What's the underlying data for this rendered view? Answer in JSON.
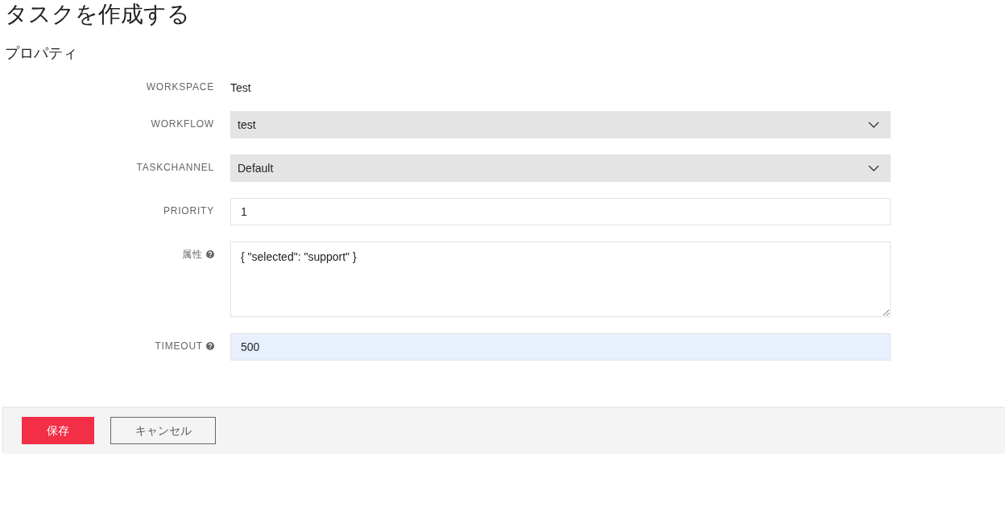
{
  "title": "タスクを作成する",
  "section": "プロパティ",
  "fields": [
    {
      "kind": "static",
      "label": "WORKSPACE",
      "help": false,
      "value": "Test"
    },
    {
      "kind": "select",
      "label": "WORKFLOW",
      "help": false,
      "value": "test"
    },
    {
      "kind": "select",
      "label": "TASKCHANNEL",
      "help": false,
      "value": "Default"
    },
    {
      "kind": "input",
      "label": "PRIORITY",
      "help": false,
      "value": "1",
      "autofilled": false
    },
    {
      "kind": "textarea",
      "label": "属性",
      "help": true,
      "value": "{ \"selected\": \"support\" }"
    },
    {
      "kind": "input",
      "label": "TIMEOUT",
      "help": true,
      "value": "500",
      "autofilled": true
    }
  ],
  "buttons": [
    {
      "kind": "primary",
      "label": "保存"
    },
    {
      "kind": "secondary",
      "label": "キャンセル"
    }
  ]
}
